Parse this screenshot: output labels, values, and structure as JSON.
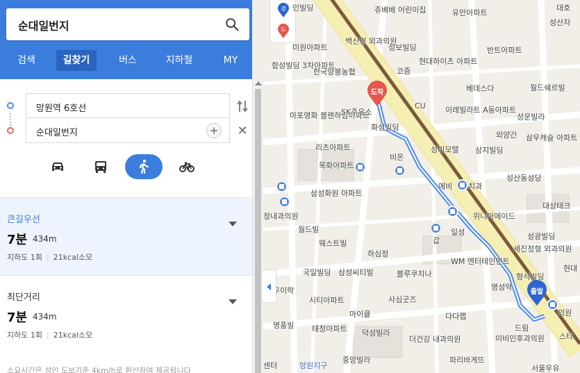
{
  "search": {
    "query": "순대일번지"
  },
  "tabs": [
    "검색",
    "길찾기",
    "버스",
    "지하철",
    "MY"
  ],
  "route": {
    "start": "망원역 6호선",
    "end": "순대일번지"
  },
  "modes": [
    "car-icon",
    "bus-icon",
    "walk-icon",
    "bike-icon"
  ],
  "results": [
    {
      "title": "큰길우선",
      "time": "7분",
      "distance": "434m",
      "underpass": "지하도 1회",
      "calories": "21kcal소모"
    },
    {
      "title": "최단거리",
      "time": "7분",
      "distance": "434m",
      "underpass": "지하도 1회",
      "calories": "21kcal소모"
    }
  ],
  "footnote": "소요시간은 성인 도보기준 4km/h로 환산하여 제공됩니다",
  "map": {
    "labels": [
      "인빌딩",
      "쥬베베 어린이집",
      "유안아파트",
      "대호",
      "성산자",
      "백신경 외과의원",
      "미원아파트",
      "성보빌딩",
      "반트아파트",
      "함성빌딩 3차아파트",
      "한국양봉농협",
      "코즘",
      "현대하이츠 아파트",
      "베데스다",
      "월드쉐르빌",
      "마포영화 블렌하임아파트",
      "SK주유소",
      "CU",
      "이레빌라트 A동아파트",
      "성운빌라",
      "화성빌딩",
      "외양간",
      "삼우캐슬 아파트",
      "리츠아파트",
      "비온",
      "성미모텔",
      "삼지빌딩",
      "목화아파트",
      "에비",
      "치과",
      "성산동성당",
      "삼성화원 아파트",
      "대상테크",
      "정내과의원",
      "월드빌",
      "위니아에이드",
      "일성",
      "웨스트빌",
      "성광빌딩",
      "하심정",
      "갑",
      "세진정형 외과의원",
      "국일빌딩",
      "삼성씨티빌",
      "블루쿠치나",
      "WM 엔터테인먼트",
      "형석빌딩",
      "현대",
      "우이락",
      "사심굿즈",
      "명성약",
      "시티아파트",
      "마이클",
      "다다랩",
      "명품빌",
      "태청아파트",
      "드림",
      "이비인후과의원",
      "덕성빌라",
      "더건강 내과의원",
      "센터",
      "망원지구",
      "중앙빌라",
      "파리바게뜨",
      "서울우유",
      "스타",
      "의원"
    ],
    "pins": {
      "arrive": "도착",
      "depart": "출발"
    },
    "layer_buttons": [
      "경",
      "도"
    ]
  },
  "colors": {
    "accent": "#3b7ddd",
    "route": "#4a8af4",
    "arrive_pin": "#e4574c",
    "depart_pin": "#2c64d4",
    "rail": "#7a5a3c",
    "main_road": "#f6efb3"
  }
}
